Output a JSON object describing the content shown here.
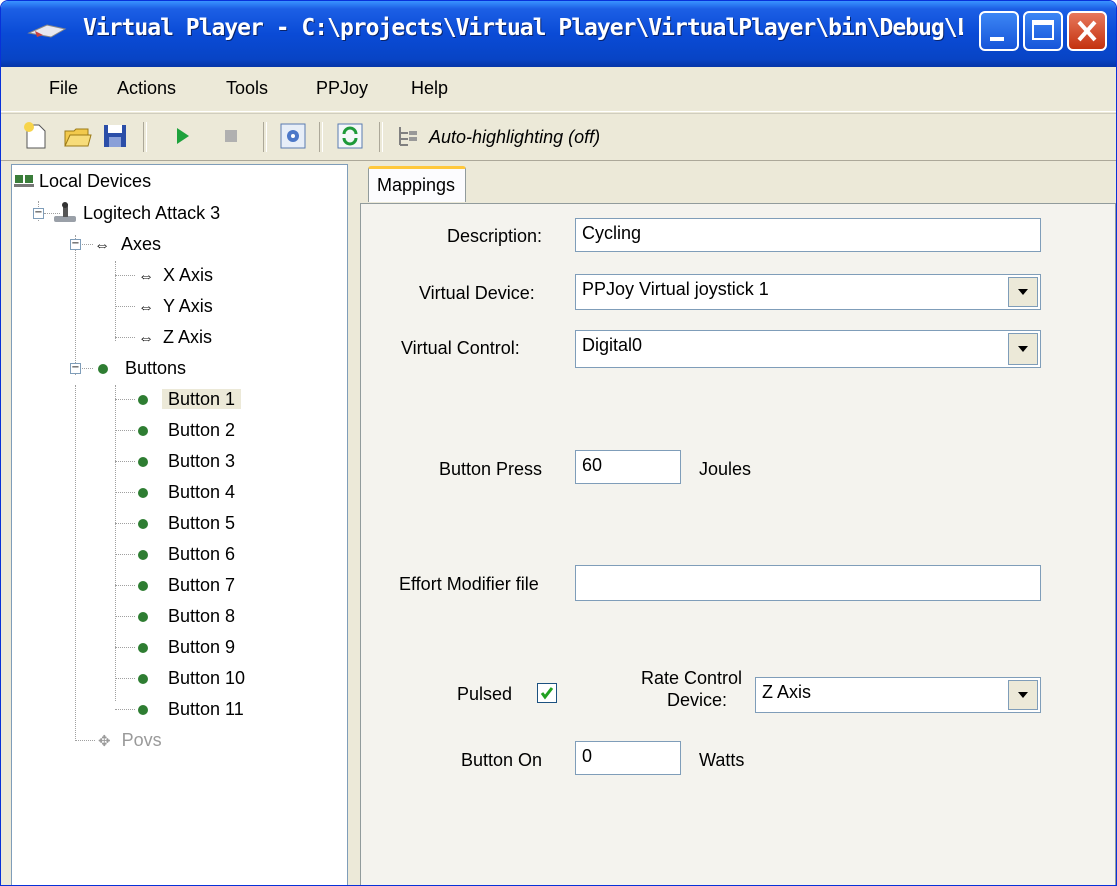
{
  "window": {
    "title": "Virtual Player - C:\\projects\\Virtual Player\\VirtualPlayer\\bin\\Debug\\Lo..."
  },
  "menu": [
    "File",
    "Actions",
    "Tools",
    "PPJoy",
    "Help"
  ],
  "toolbar": {
    "auto_highlight_label": "Auto-highlighting (off)"
  },
  "tree": {
    "root": "Local Devices",
    "device": "Logitech Attack 3",
    "axes_group": "Axes",
    "axes": [
      "X Axis",
      "Y Axis",
      "Z Axis"
    ],
    "buttons_group": "Buttons",
    "buttons": [
      "Button 1",
      "Button 2",
      "Button 3",
      "Button 4",
      "Button 5",
      "Button 6",
      "Button 7",
      "Button 8",
      "Button 9",
      "Button 10",
      "Button 11"
    ],
    "povs": "Povs",
    "selected": "Button 1"
  },
  "tab": {
    "label": "Mappings"
  },
  "form": {
    "description_label": "Description:",
    "description_value": "Cycling",
    "virtual_device_label": "Virtual Device:",
    "virtual_device_value": "PPJoy Virtual joystick 1",
    "virtual_control_label": "Virtual Control:",
    "virtual_control_value": "Digital0",
    "button_press_label": "Button Press",
    "button_press_value": "60",
    "button_press_unit": "Joules",
    "effort_modifier_label": "Effort Modifier file",
    "effort_modifier_value": "",
    "pulsed_label": "Pulsed",
    "pulsed_checked": true,
    "rate_control_label_line1": "Rate Control",
    "rate_control_label_line2": "Device:",
    "rate_control_value": "Z Axis",
    "button_on_label": "Button On",
    "button_on_value": "0",
    "button_on_unit": "Watts"
  },
  "colors": {
    "titlebar": "#0A4BD6",
    "face": "#ECE9D8",
    "accent_tab": "#FFC83C"
  }
}
